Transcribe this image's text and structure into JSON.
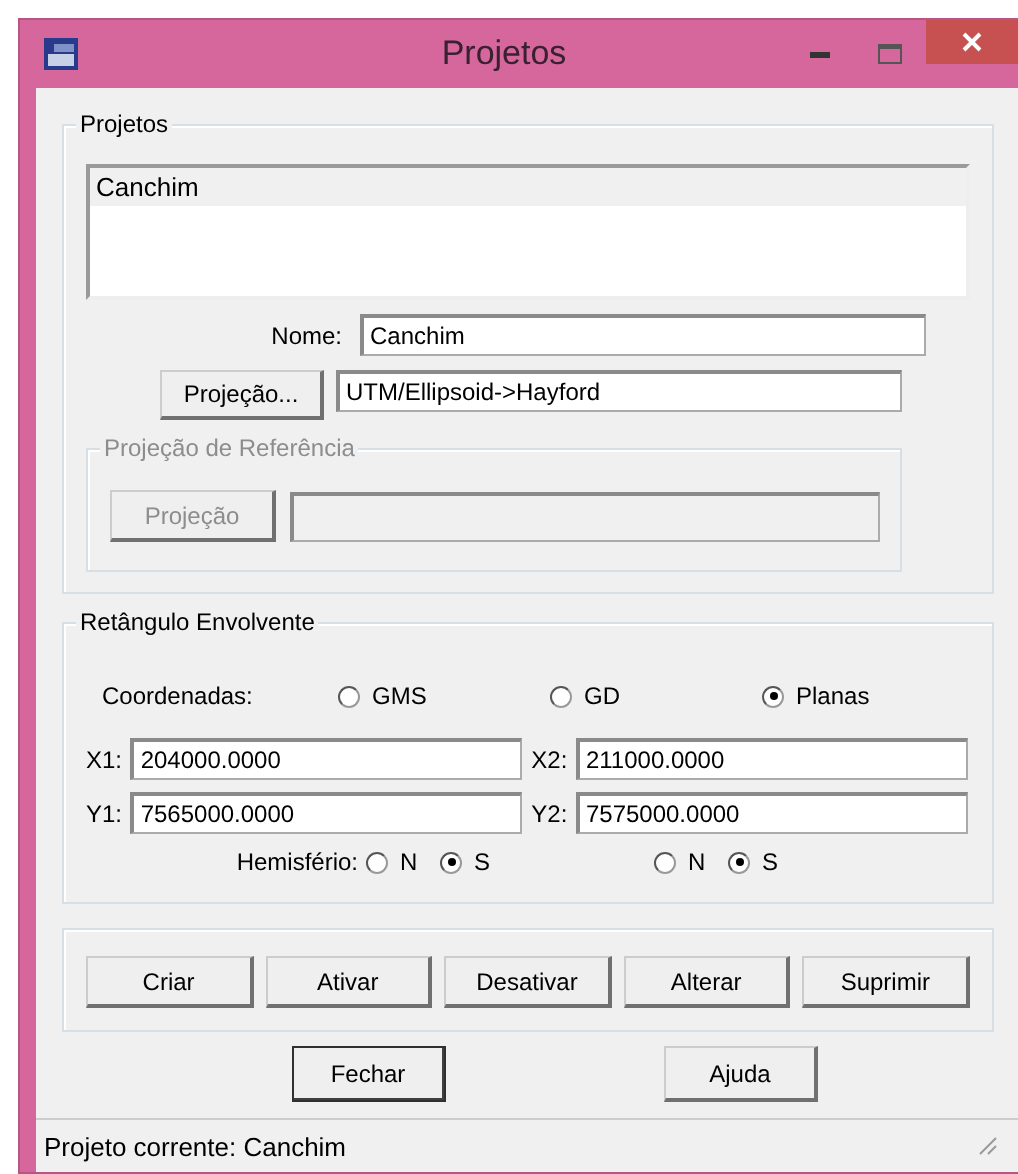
{
  "window": {
    "title": "Projetos"
  },
  "projects": {
    "title": "Projetos",
    "list": [
      {
        "label": "Canchim",
        "selected": true
      }
    ],
    "name_label": "Nome:",
    "name_value": "Canchim",
    "projection_button": "Projeção...",
    "projection_value": "UTM/Ellipsoid->Hayford",
    "reference": {
      "title": "Projeção de Referência",
      "button": "Projeção",
      "disabled": true
    }
  },
  "bounds": {
    "title": "Retângulo Envolvente",
    "coord_label": "Coordenadas:",
    "coord_options": [
      {
        "label": "GMS",
        "selected": false
      },
      {
        "label": "GD",
        "selected": false
      },
      {
        "label": "Planas",
        "selected": true
      }
    ],
    "fields": [
      {
        "label": "X1:",
        "value": "204000.0000"
      },
      {
        "label": "X2:",
        "value": "211000.0000"
      },
      {
        "label": "Y1:",
        "value": "7565000.0000"
      },
      {
        "label": "Y2:",
        "value": "7575000.0000"
      }
    ],
    "hemisphere_label": "Hemisfério:",
    "hemispheres": [
      [
        {
          "label": "N",
          "selected": false
        },
        {
          "label": "S",
          "selected": true
        }
      ],
      [
        {
          "label": "N",
          "selected": false
        },
        {
          "label": "S",
          "selected": true
        }
      ]
    ]
  },
  "actions": [
    "Criar",
    "Ativar",
    "Desativar",
    "Alterar",
    "Suprimir"
  ],
  "bottom_buttons": [
    {
      "label": "Fechar",
      "default": true
    },
    {
      "label": "Ajuda",
      "default": false
    }
  ],
  "status": "Projeto corrente: Canchim"
}
